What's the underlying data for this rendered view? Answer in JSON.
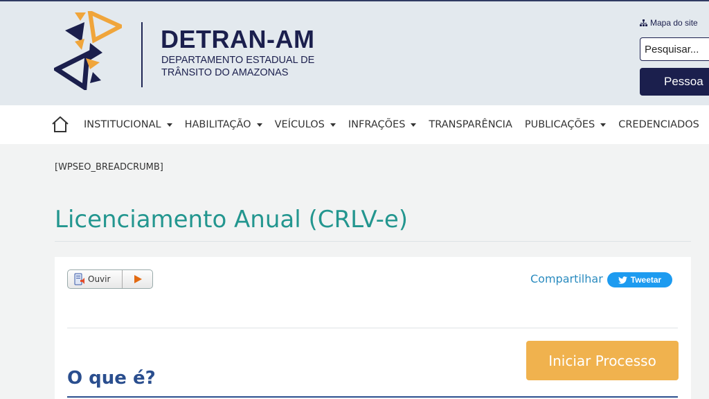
{
  "header": {
    "brand_title": "DETRAN-AM",
    "brand_sub_line1": "DEPARTAMENTO ESTADUAL DE",
    "brand_sub_line2": "TRÂNSITO DO AMAZONAS",
    "sitemap_label": "Mapa do site",
    "search_placeholder": "Pesquisar...",
    "pessoa_label": "Pessoa"
  },
  "nav": {
    "home_icon": "home-icon",
    "items": [
      {
        "label": "INSTITUCIONAL",
        "dropdown": true
      },
      {
        "label": "HABILITAÇÃO",
        "dropdown": true
      },
      {
        "label": "VEÍCULOS",
        "dropdown": true
      },
      {
        "label": "INFRAÇÕES",
        "dropdown": true
      },
      {
        "label": "TRANSPARÊNCIA",
        "dropdown": false
      },
      {
        "label": "PUBLICAÇÕES",
        "dropdown": true
      },
      {
        "label": "CREDENCIADOS",
        "dropdown": false
      }
    ]
  },
  "breadcrumb": "[WPSEO_BREADCRUMB]",
  "page_title": "Licenciamento Anual (CRLV-e)",
  "card": {
    "ouvir_label": "Ouvir",
    "share_label": "Compartilhar",
    "tweet_label": "Tweetar",
    "iniciar_label": "Iniciar Processo",
    "section_title": "O que é?"
  },
  "colors": {
    "navy": "#1b1f4d",
    "teal": "#23968f",
    "orange": "#f0b24e",
    "twitter": "#1d9bf0",
    "section_blue": "#2a4e8e"
  }
}
